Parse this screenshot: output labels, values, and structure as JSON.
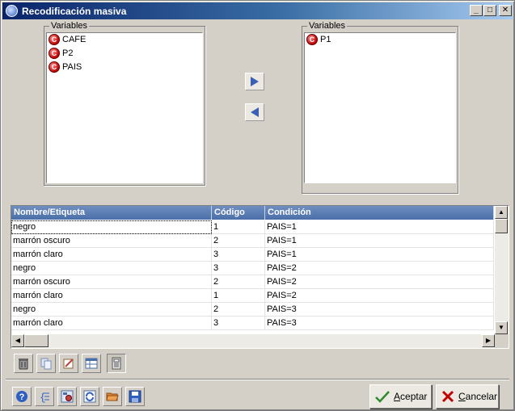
{
  "window": {
    "title": "Recodificación masiva",
    "min_glyph": "_",
    "max_glyph": "□",
    "close_glyph": "✕"
  },
  "left_panel": {
    "label": "Variables",
    "items": [
      {
        "label": "CAFE",
        "icon": "variable-c-icon",
        "glyph": "C"
      },
      {
        "label": "P2",
        "icon": "variable-c-icon",
        "glyph": "C"
      },
      {
        "label": "PAIS",
        "icon": "variable-c-icon",
        "glyph": "C"
      }
    ]
  },
  "right_panel": {
    "label": "Variables",
    "items": [
      {
        "label": "P1",
        "icon": "variable-c-icon",
        "glyph": "C"
      }
    ]
  },
  "transfer": {
    "move_right_icon": "arrow-right-icon",
    "move_left_icon": "arrow-left-icon"
  },
  "grid": {
    "columns": [
      "Nombre/Etiqueta",
      "Código",
      "Condición"
    ],
    "rows": [
      {
        "nombre": "negro",
        "codigo": "1",
        "condicion": "PAIS=1"
      },
      {
        "nombre": "marrón oscuro",
        "codigo": "2",
        "condicion": "PAIS=1"
      },
      {
        "nombre": "marrón claro",
        "codigo": "3",
        "condicion": "PAIS=1"
      },
      {
        "nombre": "negro",
        "codigo": "3",
        "condicion": "PAIS=2"
      },
      {
        "nombre": "marrón oscuro",
        "codigo": "2",
        "condicion": "PAIS=2"
      },
      {
        "nombre": "marrón claro",
        "codigo": "1",
        "condicion": "PAIS=2"
      },
      {
        "nombre": "negro",
        "codigo": "2",
        "condicion": "PAIS=3"
      },
      {
        "nombre": "marrón claro",
        "codigo": "3",
        "condicion": "PAIS=3"
      }
    ]
  },
  "grid_toolbar": [
    {
      "name": "trash-icon"
    },
    {
      "name": "copy-icon"
    },
    {
      "name": "edit-icon"
    },
    {
      "name": "grid-table-icon"
    },
    {
      "name": "calculator-icon"
    }
  ],
  "bottom_toolbar": [
    {
      "name": "help-icon"
    },
    {
      "name": "braces-icon"
    },
    {
      "name": "settings-icon"
    },
    {
      "name": "refresh-icon"
    },
    {
      "name": "open-folder-icon"
    },
    {
      "name": "save-icon"
    }
  ],
  "actions": {
    "accept_label": "ceptar",
    "accept_mnemonic": "A",
    "cancel_label": "ancelar",
    "cancel_mnemonic": "C"
  },
  "colors": {
    "grid_header": "#4a6ea8",
    "title_start": "#0a246a",
    "title_end": "#a6caf0",
    "accept_check": "#2f8a2f",
    "cancel_x": "#c00000"
  }
}
